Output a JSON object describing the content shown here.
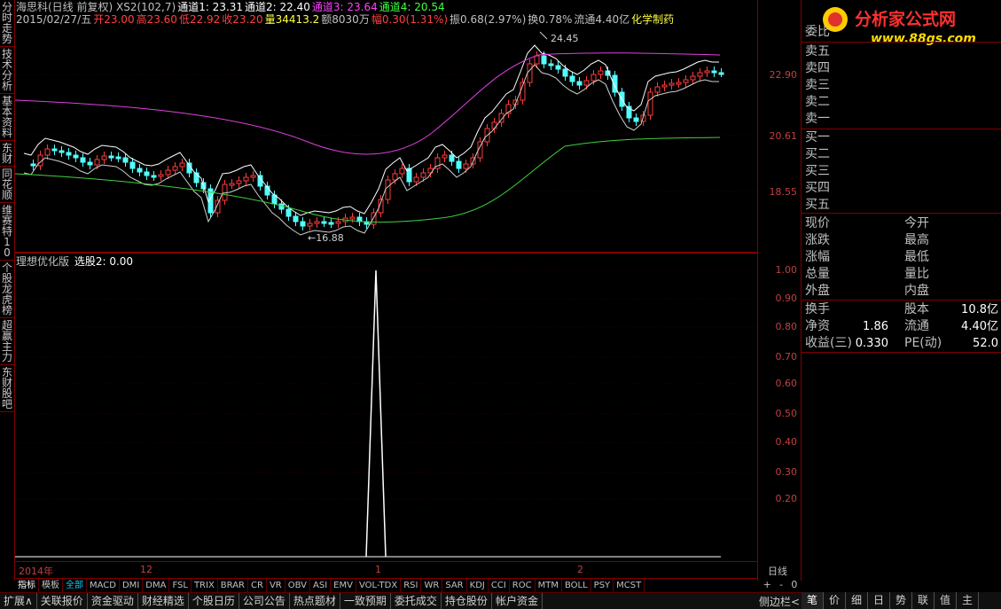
{
  "left_tabs": [
    "分时走势",
    "技术分析",
    "基本资料",
    "东财",
    "同花顺",
    "维赛特10",
    "个股龙虎榜",
    "超赢主力",
    "东财股吧"
  ],
  "header": {
    "line1": [
      {
        "text": "海思科(日线 前复权) XS2(102,7)",
        "color": "#c0c0c0"
      },
      {
        "text": "通道1: 23.31",
        "color": "#ffffff"
      },
      {
        "text": "通道2: 22.40",
        "color": "#ffffff"
      },
      {
        "text": "通道3: 23.64",
        "color": "#ff40ff"
      },
      {
        "text": "通道4: 20.54",
        "color": "#40ff40"
      }
    ],
    "line2": [
      {
        "text": "2015/02/27/五",
        "color": "#c0c0c0"
      },
      {
        "text": "开23.00",
        "color": "#ff4040"
      },
      {
        "text": "高23.60",
        "color": "#ff4040"
      },
      {
        "text": "低22.92",
        "color": "#ff4040"
      },
      {
        "text": "收23.20",
        "color": "#ff4040"
      },
      {
        "text": "量34413.2",
        "color": "#ffff40"
      },
      {
        "text": "额8030万",
        "color": "#c0c0c0"
      },
      {
        "text": "幅0.30(1.31%)",
        "color": "#ff4040"
      },
      {
        "text": "振0.68(2.97%)",
        "color": "#c0c0c0"
      },
      {
        "text": "换0.78%",
        "color": "#c0c0c0"
      },
      {
        "text": "流通4.40亿",
        "color": "#c0c0c0"
      },
      {
        "text": "化学制药",
        "color": "#ffff40"
      }
    ]
  },
  "annotations": {
    "high": "24.45",
    "low": "16.88"
  },
  "indicator": {
    "title": "理想优化版",
    "label": "选股2: 0.00"
  },
  "price_axis": [
    "22.90",
    "20.61",
    "18.55"
  ],
  "ind_axis": [
    "1.00",
    "0.90",
    "0.80",
    "0.70",
    "0.60",
    "0.50",
    "0.40",
    "0.30",
    "0.20"
  ],
  "date_labels": [
    "2014年",
    "12",
    "1",
    "2"
  ],
  "period": "日线",
  "zoom": [
    "+",
    "-",
    "0"
  ],
  "ind_tabs": [
    {
      "label": "指标",
      "style": "active"
    },
    {
      "label": "模板",
      "style": ""
    },
    {
      "label": "全部",
      "style": "blue"
    },
    {
      "label": "MACD",
      "style": ""
    },
    {
      "label": "DMI",
      "style": ""
    },
    {
      "label": "DMA",
      "style": ""
    },
    {
      "label": "FSL",
      "style": ""
    },
    {
      "label": "TRIX",
      "style": ""
    },
    {
      "label": "BRAR",
      "style": ""
    },
    {
      "label": "CR",
      "style": ""
    },
    {
      "label": "VR",
      "style": ""
    },
    {
      "label": "OBV",
      "style": ""
    },
    {
      "label": "ASI",
      "style": ""
    },
    {
      "label": "EMV",
      "style": ""
    },
    {
      "label": "VOL-TDX",
      "style": ""
    },
    {
      "label": "RSI",
      "style": ""
    },
    {
      "label": "WR",
      "style": ""
    },
    {
      "label": "SAR",
      "style": ""
    },
    {
      "label": "KDJ",
      "style": ""
    },
    {
      "label": "CCI",
      "style": ""
    },
    {
      "label": "ROC",
      "style": ""
    },
    {
      "label": "MTM",
      "style": ""
    },
    {
      "label": "BOLL",
      "style": ""
    },
    {
      "label": "PSY",
      "style": ""
    },
    {
      "label": "MCST",
      "style": ""
    }
  ],
  "bottom_tabs": [
    "扩展∧",
    "关联报价",
    "资金驱动",
    "财经精选",
    "个股日历",
    "公司公告",
    "热点题材",
    "一致预期",
    "委托成交",
    "持仓股份",
    "帐户资金"
  ],
  "side_tabs": [
    "笔",
    "价",
    "细",
    "日",
    "势",
    "联",
    "值",
    "主"
  ],
  "side_label": "侧边栏<",
  "logo": {
    "text": "分析家公式网",
    "url": "www.88gs.com"
  },
  "orderbook": {
    "ratio_label": "委比",
    "sells": [
      "卖五",
      "卖四",
      "卖三",
      "卖二",
      "卖一"
    ],
    "buys": [
      "买一",
      "买二",
      "买三",
      "买四",
      "买五"
    ]
  },
  "quote1": [
    {
      "l1": "现价",
      "v1": "",
      "l2": "今开",
      "v2": ""
    },
    {
      "l1": "涨跌",
      "v1": "",
      "l2": "最高",
      "v2": ""
    },
    {
      "l1": "涨幅",
      "v1": "",
      "l2": "最低",
      "v2": ""
    },
    {
      "l1": "总量",
      "v1": "",
      "l2": "量比",
      "v2": ""
    },
    {
      "l1": "外盘",
      "v1": "",
      "l2": "内盘",
      "v2": ""
    }
  ],
  "quote2": [
    {
      "l1": "换手",
      "v1": "",
      "l2": "股本",
      "v2": "10.8亿"
    },
    {
      "l1": "净资",
      "v1": "1.86",
      "l2": "流通",
      "v2": "4.40亿"
    },
    {
      "l1": "收益(三)",
      "v1": "0.330",
      "l2": "PE(动)",
      "v2": "52.0"
    }
  ],
  "colors": {
    "up": "#ff3c3c",
    "down": "#54ffff",
    "grid": "#800000",
    "ch1": "#ffffff",
    "ch3": "#e040e0",
    "ch4": "#40d040"
  }
}
